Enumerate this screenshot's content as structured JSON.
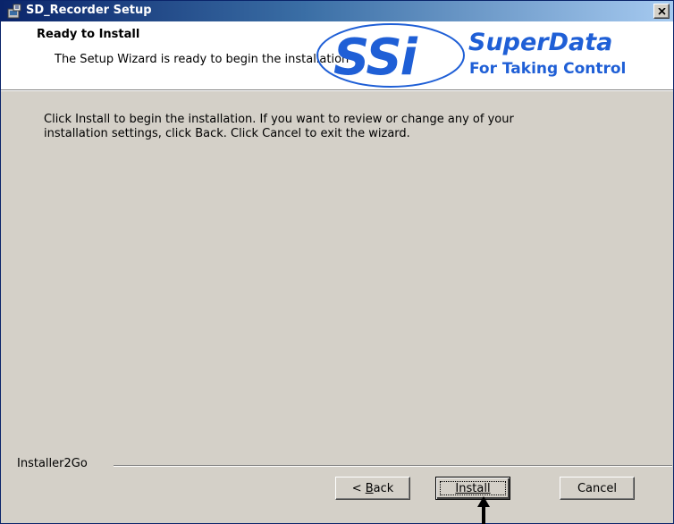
{
  "window": {
    "title": "SD_Recorder Setup",
    "close_glyph": "×",
    "icon": "installer-icon"
  },
  "banner": {
    "title": "Ready to Install",
    "subtitle": "The Setup Wizard is ready to begin the installation",
    "logo": {
      "mark": "SSi",
      "brand": "SuperData",
      "tagline": "For Taking Control",
      "color": "#1f5fd6"
    }
  },
  "body": {
    "line1": "Click Install to begin the installation.  If you want to review or change any of your",
    "line2": "installation settings, click Back.  Click Cancel to exit the wizard."
  },
  "footer": {
    "label": "Installer2Go"
  },
  "buttons": {
    "back": {
      "prefix": "< ",
      "mnemonic": "B",
      "rest": "ack"
    },
    "install": {
      "mnemonic": "I",
      "rest": "nstall"
    },
    "cancel": {
      "label": "Cancel"
    }
  },
  "colors": {
    "title_bar": "#0a246a",
    "face": "#d4d0c8",
    "brand_blue": "#1f5fd6"
  }
}
